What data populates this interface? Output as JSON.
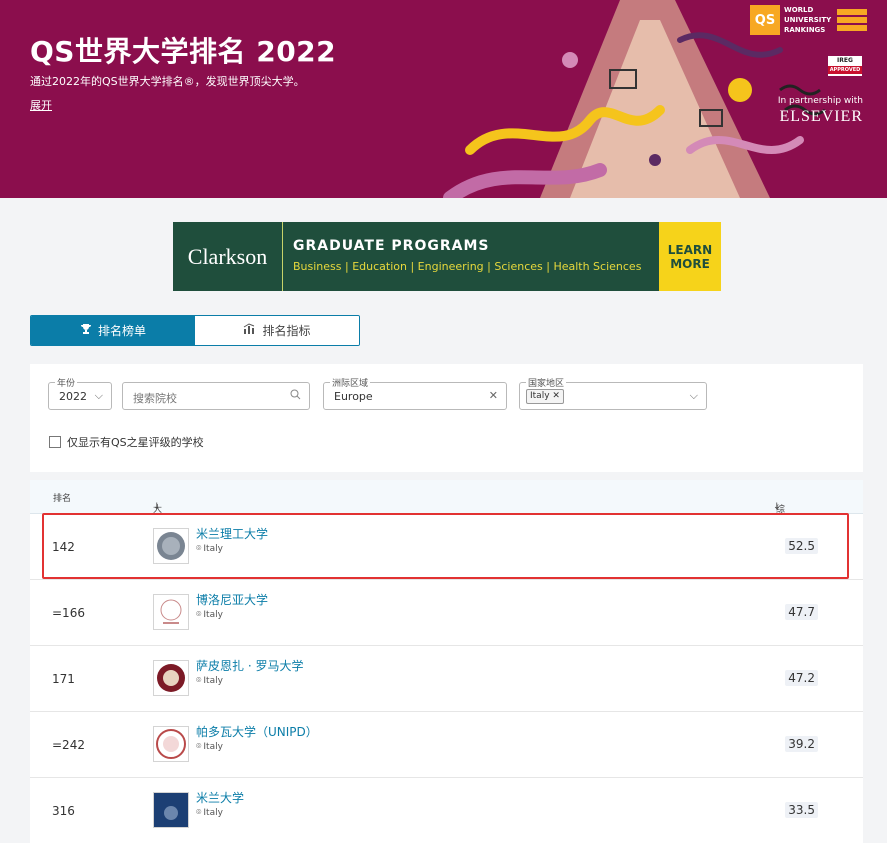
{
  "banner": {
    "title": "QS世界大学排名 2022",
    "subtitle": "通过2022年的QS世界大学排名®，发现世界顶尖大学。",
    "expand_label": "展开",
    "qs_logo_box": "QS",
    "qs_logo_text": [
      "WORLD",
      "UNIVERSITY",
      "RANKINGS"
    ],
    "ireg_badge": "IREG",
    "ireg_sub": "APPROVED",
    "partner_line": "In partnership with",
    "partner_name": "ELSEVIER"
  },
  "ad": {
    "brand": "Clarkson",
    "headline": "GRADUATE PROGRAMS",
    "fields": "Business | Education | Engineering | Sciences | Health Sciences",
    "cta": "LEARN MORE"
  },
  "tabs": [
    {
      "label": "排名榜单",
      "icon": "trophy-icon",
      "active": true
    },
    {
      "label": "排名指标",
      "icon": "chart-icon",
      "active": false
    }
  ],
  "filters": {
    "year": {
      "label": "年份",
      "value": "2022"
    },
    "search": {
      "placeholder": "搜索院校"
    },
    "region": {
      "label": "洲际区域",
      "value": "Europe"
    },
    "country": {
      "label": "国家地区",
      "chip": "Italy"
    },
    "stars_only": "仅显示有QS之星评级的学校"
  },
  "table": {
    "headers": {
      "rank": "排名",
      "university": "大学",
      "score": "综合得分"
    },
    "rows": [
      {
        "rank": "142",
        "name": "米兰理工大学",
        "location": "Italy",
        "score": "52.5"
      },
      {
        "rank": "=166",
        "name": "博洛尼亚大学",
        "location": "Italy",
        "score": "47.7"
      },
      {
        "rank": "171",
        "name": "萨皮恩扎 · 罗马大学",
        "location": "Italy",
        "score": "47.2"
      },
      {
        "rank": "=242",
        "name": "帕多瓦大学（UNIPD）",
        "location": "Italy",
        "score": "39.2"
      },
      {
        "rank": "316",
        "name": "米兰大学",
        "location": "Italy",
        "score": "33.5"
      }
    ]
  },
  "colors": {
    "banner": "#8b0e4d",
    "accent": "#0b7da8",
    "highlight": "#e23232"
  }
}
